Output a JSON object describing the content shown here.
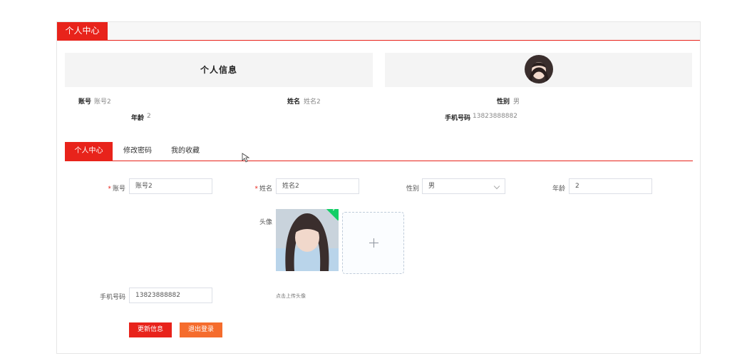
{
  "header": {
    "tab_label": "个人中心"
  },
  "info": {
    "title": "个人信息",
    "account_label": "账号",
    "account_value": "账号2",
    "name_label": "姓名",
    "name_value": "姓名2",
    "gender_label": "性别",
    "gender_value": "男",
    "age_label": "年龄",
    "age_value": "2",
    "phone_label": "手机号码",
    "phone_value": "13823888882"
  },
  "tabs": [
    {
      "label": "个人中心",
      "active": true
    },
    {
      "label": "修改密码",
      "active": false
    },
    {
      "label": "我的收藏",
      "active": false
    }
  ],
  "form": {
    "required_mark": "*",
    "account_label": "账号",
    "account_value": "账号2",
    "name_label": "姓名",
    "name_value": "姓名2",
    "gender_label": "性别",
    "gender_value": "男",
    "age_label": "年龄",
    "age_value": "2",
    "avatar_label": "头像",
    "avatar_hint": "点击上传头像",
    "phone_label": "手机号码",
    "phone_value": "13823888882",
    "update_button": "更新信息",
    "logout_button": "退出登录"
  },
  "colors": {
    "accent": "#e8231b",
    "logout": "#f56c2d",
    "success": "#13ce66"
  },
  "icons": {
    "upload": "plus-icon",
    "uploaded": "check-icon",
    "pointer": "cursor-icon"
  }
}
